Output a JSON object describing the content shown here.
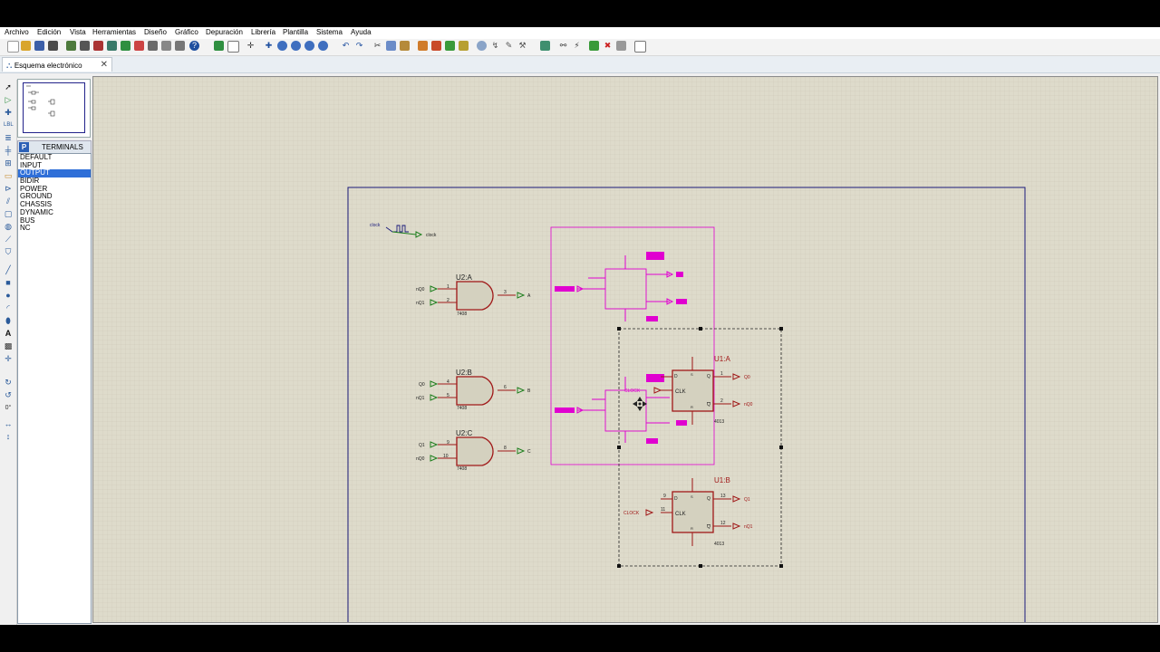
{
  "menu": [
    "Archivo",
    "Edición",
    "Vista",
    "Herramientas",
    "Diseño",
    "Gráfico",
    "Depuración",
    "Librería",
    "Plantilla",
    "Sistema",
    "Ayuda"
  ],
  "tab": {
    "title": "Esquema electrónico",
    "close": "✕"
  },
  "terminals": {
    "header": "TERMINALS",
    "badge": "P",
    "items": [
      "DEFAULT",
      "INPUT",
      "OUTPUT",
      "BIDIR",
      "POWER",
      "GROUND",
      "CHASSIS",
      "DYNAMIC",
      "BUS",
      "NC"
    ],
    "selected_index": 2
  },
  "rotation_readout": "0°",
  "colors": {
    "grid_bg": "#dedbcb",
    "wire_green": "#1e7f1e",
    "component_red": "#a01818",
    "highlight_magenta": "#e000d0",
    "sheet_border": "#1a1a7a"
  },
  "schematic": {
    "clock": {
      "label_left": "clock",
      "label_right": "clock"
    },
    "gates": [
      {
        "ref": "U2:A",
        "part": "7408",
        "inputs": [
          "nQ0",
          "nQ1"
        ],
        "pins": [
          "1",
          "2",
          "3"
        ],
        "output": "A"
      },
      {
        "ref": "U2:B",
        "part": "7408",
        "inputs": [
          "Q0",
          "nQ1"
        ],
        "pins": [
          "4",
          "5",
          "6"
        ],
        "output": "B"
      },
      {
        "ref": "U2:C",
        "part": "7408",
        "inputs": [
          "Q1",
          "nQ0"
        ],
        "pins": [
          "9",
          "10",
          "8"
        ],
        "output": "C"
      }
    ],
    "flipflops": [
      {
        "ref": "U1:A",
        "part": "4013",
        "clock": "CLOCK",
        "outputs": [
          "Q0",
          "nQ0"
        ],
        "pins": [
          "1",
          "2"
        ]
      },
      {
        "ref": "U1:B",
        "part": "4013",
        "clock": "CLOCK",
        "outputs": [
          "Q1",
          "nQ1"
        ],
        "pins": [
          "9",
          "11",
          "13",
          "12"
        ]
      }
    ],
    "ff_pin_labels": {
      "d": "D",
      "clk": "CLK",
      "q": "Q",
      "nq": "Q",
      "s": "S",
      "r": "R"
    },
    "ghost_clock": "CLOCK"
  }
}
